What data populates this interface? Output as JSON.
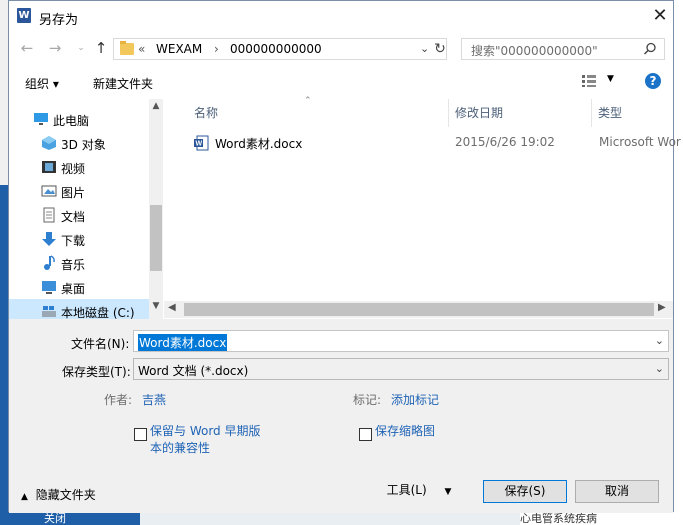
{
  "window": {
    "title": "另存为"
  },
  "address": {
    "prefix": "«",
    "segments": [
      "WEXAM",
      "000000000000"
    ],
    "separator": "›"
  },
  "search": {
    "placeholder": "搜索\"000000000000\""
  },
  "toolbar": {
    "organize": "组织 ▾",
    "new_folder": "新建文件夹",
    "help": "?"
  },
  "sidebar": {
    "items": [
      {
        "label": "此电脑",
        "icon": "computer-icon"
      },
      {
        "label": "3D 对象",
        "icon": "3d-objects-icon"
      },
      {
        "label": "视频",
        "icon": "video-icon"
      },
      {
        "label": "图片",
        "icon": "pictures-icon"
      },
      {
        "label": "文档",
        "icon": "documents-icon"
      },
      {
        "label": "下载",
        "icon": "download-icon"
      },
      {
        "label": "音乐",
        "icon": "music-icon"
      },
      {
        "label": "桌面",
        "icon": "desktop-icon"
      },
      {
        "label": "本地磁盘 (C:)",
        "icon": "drive-icon"
      }
    ]
  },
  "filelist": {
    "columns": [
      "名称",
      "修改日期",
      "类型"
    ],
    "rows": [
      {
        "name": "Word素材.docx",
        "modified": "2015/6/26 19:02",
        "type": "Microsoft Wor"
      }
    ]
  },
  "form": {
    "filename_label": "文件名(N):",
    "filename_value": "Word素材.docx",
    "filetype_label": "保存类型(T):",
    "filetype_value": "Word 文档 (*.docx)",
    "author_label": "作者:",
    "author_value": "吉燕",
    "tags_label": "标记:",
    "tags_value": "添加标记",
    "compat_line1": "保留与 Word 早期版",
    "compat_line2": "本的兼容性",
    "thumbnail": "保存缩略图",
    "hide_folders": "隐藏文件夹",
    "tools": "工具(L)",
    "save": "保存(S)",
    "cancel": "取消"
  },
  "background": {
    "bottom_left": "关闭",
    "bottom_right": "心电管系统疾病"
  },
  "colors": {
    "accent": "#0078d7",
    "link": "#1f63b5",
    "selection": "#cce8ff"
  }
}
